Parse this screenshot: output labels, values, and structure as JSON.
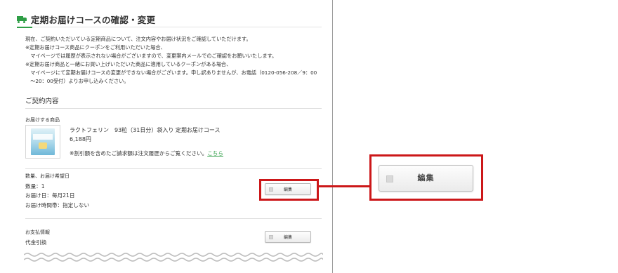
{
  "page": {
    "title": "定期お届けコースの確認・変更",
    "notice_lines": [
      "現在、ご契約いただいている定期商品について、注文内容やお届け状況をご確認していただけます。",
      "※定期お届けコース商品にクーポンをご利用いただいた場合、",
      "　マイページでは履歴が表示されない場合がございますので、変更案内メールでのご確認をお願いいたします。",
      "※定期お届け商品と一緒にお買い上げいただいた商品に適用しているクーポンがある場合、",
      "　マイページにて定期お届けコースの変更ができない場合がございます。申し訳ありませんが、お電話（0120-056-208／9：00",
      "　〜20：00受付）よりお申し込みください。"
    ],
    "section_title": "ご契約内容",
    "product": {
      "label": "お届けする商品",
      "name": "ラクトフェリン　93粒（31日分）袋入り 定期お届けコース",
      "price": "6,188円",
      "note": "※割引額を含めたご請求額は注文履歴からご覧ください。",
      "note_link": "こちら"
    },
    "delivery": {
      "label": "数量、お届け希望日",
      "quantity": "数量：1",
      "day": "お届け日：毎月21日",
      "time": "お届け時間帯：指定しない",
      "edit_label": "編集"
    },
    "payment": {
      "label": "お支払情報",
      "method": "代金引換",
      "edit_label": "編集"
    }
  },
  "callout": {
    "edit_label": "編集",
    "color": "#cc1719"
  },
  "colors": {
    "accent": "#2e9e46",
    "highlight": "#cc1719"
  }
}
